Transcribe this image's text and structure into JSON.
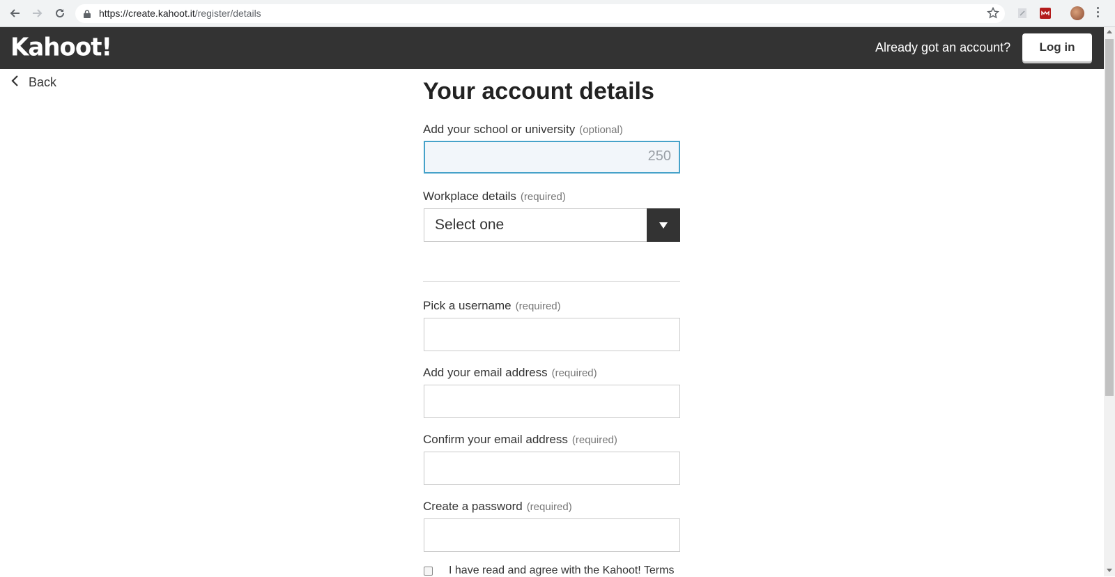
{
  "browser": {
    "url_host": "https://create.kahoot.it",
    "url_path": "/register/details"
  },
  "header": {
    "logo": "Kahoot!",
    "already_text": "Already got an account?",
    "login_label": "Log in"
  },
  "nav": {
    "back_label": "Back"
  },
  "form": {
    "title": "Your account details",
    "school": {
      "label": "Add your school or university",
      "hint": "(optional)",
      "counter": "250",
      "value": ""
    },
    "workplace": {
      "label": "Workplace details",
      "hint": "(required)",
      "selected": "Select one"
    },
    "username": {
      "label": "Pick a username",
      "hint": "(required)",
      "value": ""
    },
    "email": {
      "label": "Add your email address",
      "hint": "(required)",
      "value": ""
    },
    "confirm_email": {
      "label": "Confirm your email address",
      "hint": "(required)",
      "value": ""
    },
    "password": {
      "label": "Create a password",
      "hint": "(required)",
      "value": ""
    },
    "terms_text": "I have read and agree with the Kahoot! Terms"
  },
  "colors": {
    "header_bg": "#333333",
    "focus_border": "#46a2c9",
    "focus_bg": "#f2f6fa"
  }
}
